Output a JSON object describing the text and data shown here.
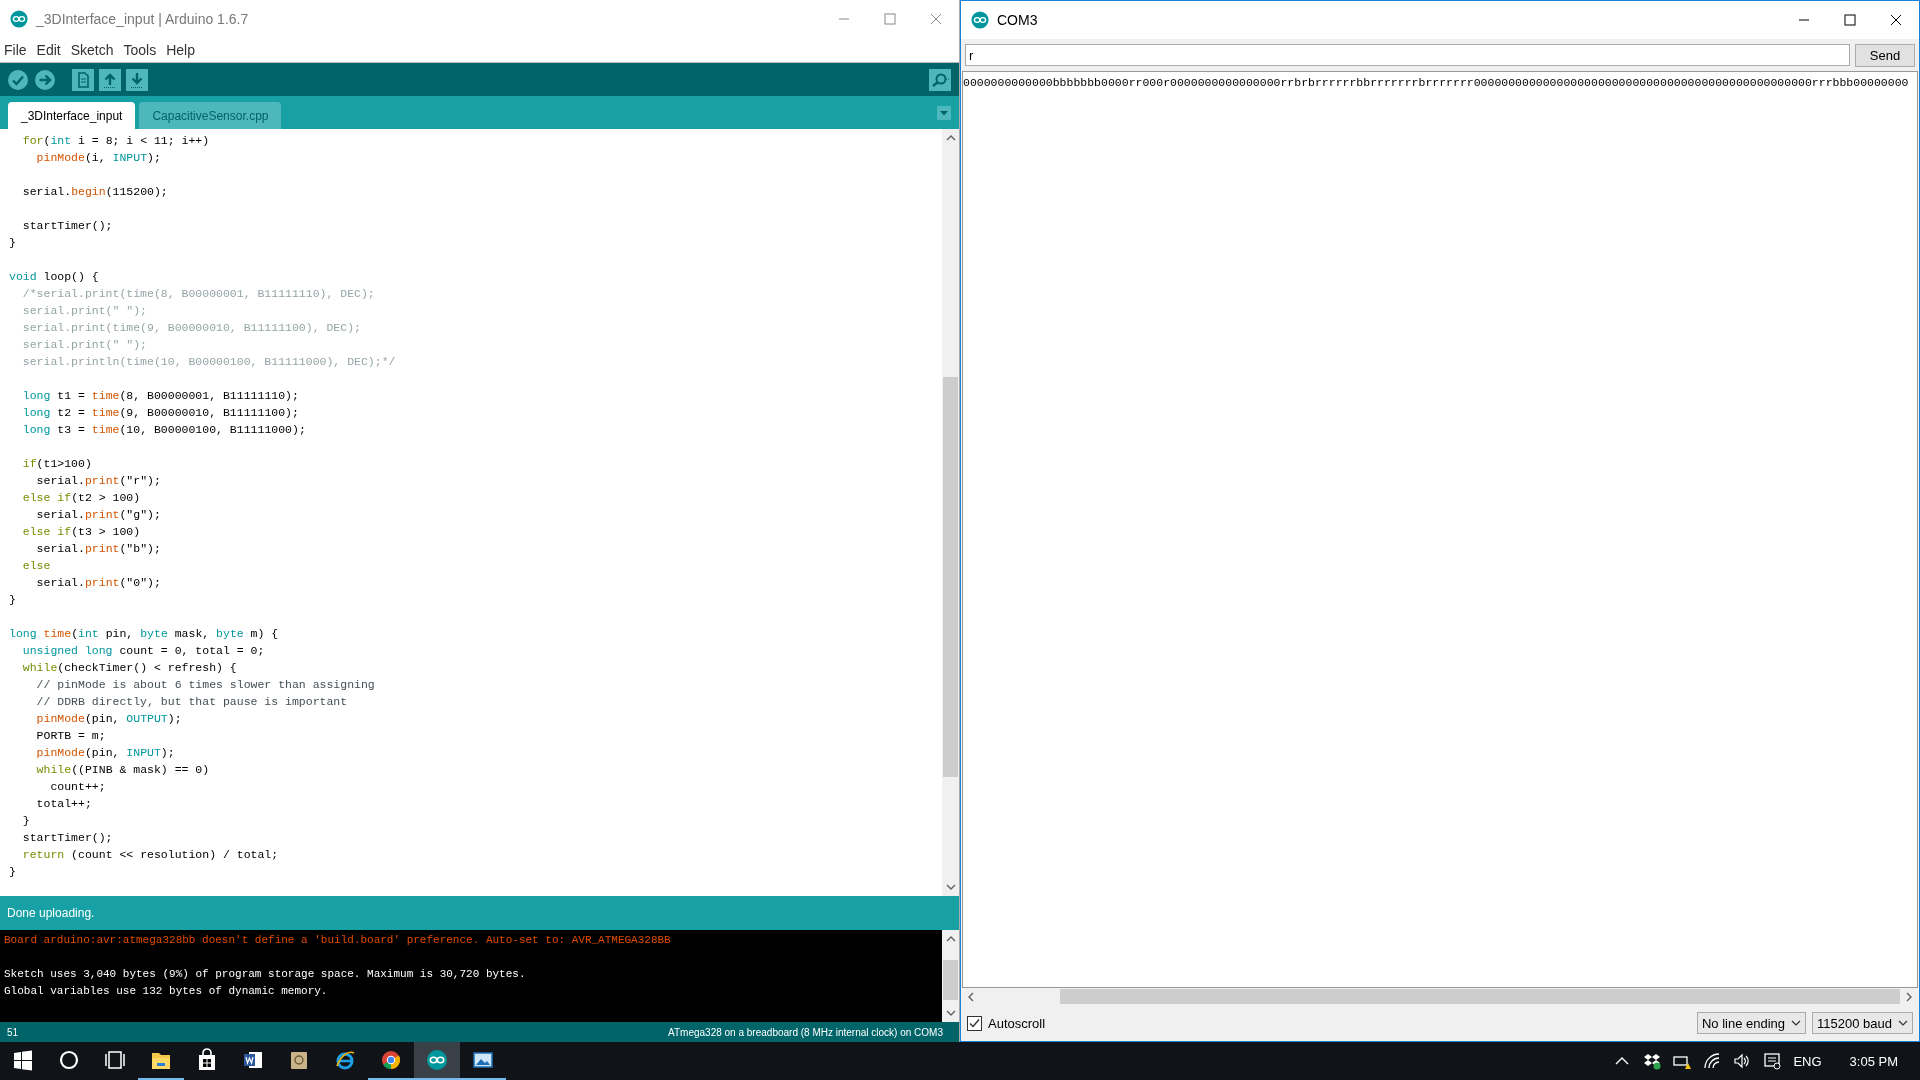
{
  "ide": {
    "title": "_3DInterface_input | Arduino 1.6.7",
    "menu": [
      "File",
      "Edit",
      "Sketch",
      "Tools",
      "Help"
    ],
    "tabs": [
      {
        "label": "_3DInterface_input",
        "selected": true
      },
      {
        "label": "CapacitiveSensor.cpp",
        "selected": false
      }
    ],
    "code_lines": [
      {
        "kind": "code",
        "tokens": [
          {
            "kind": "control",
            "text": "  for"
          },
          {
            "kind": "plain",
            "text": "("
          },
          {
            "kind": "type",
            "text": "int"
          },
          {
            "kind": "plain",
            "text": " i = 8; i < 11; i++)"
          }
        ]
      },
      {
        "kind": "code",
        "tokens": [
          {
            "kind": "function",
            "text": "    pinMode"
          },
          {
            "kind": "plain",
            "text": "(i, "
          },
          {
            "kind": "constant",
            "text": "INPUT"
          },
          {
            "kind": "plain",
            "text": ");"
          }
        ]
      },
      {
        "kind": "blank"
      },
      {
        "kind": "code",
        "tokens": [
          {
            "kind": "plain",
            "text": "  serial."
          },
          {
            "kind": "function",
            "text": "begin"
          },
          {
            "kind": "plain",
            "text": "(115200);"
          }
        ]
      },
      {
        "kind": "blank"
      },
      {
        "kind": "code",
        "tokens": [
          {
            "kind": "plain",
            "text": "  startTimer();"
          }
        ]
      },
      {
        "kind": "code",
        "tokens": [
          {
            "kind": "plain",
            "text": "}"
          }
        ]
      },
      {
        "kind": "blank"
      },
      {
        "kind": "code",
        "tokens": [
          {
            "kind": "type",
            "text": "void"
          },
          {
            "kind": "plain",
            "text": " loop() {"
          }
        ]
      },
      {
        "kind": "code",
        "tokens": [
          {
            "kind": "comment",
            "text": "  /*serial.print(time(8, B00000001, B11111110), DEC);"
          }
        ]
      },
      {
        "kind": "code",
        "tokens": [
          {
            "kind": "comment",
            "text": "  serial.print(\" \");"
          }
        ]
      },
      {
        "kind": "code",
        "tokens": [
          {
            "kind": "comment",
            "text": "  serial.print(time(9, B00000010, B11111100), DEC);"
          }
        ]
      },
      {
        "kind": "code",
        "tokens": [
          {
            "kind": "comment",
            "text": "  serial.print(\" \");"
          }
        ]
      },
      {
        "kind": "code",
        "tokens": [
          {
            "kind": "comment",
            "text": "  serial.println(time(10, B00000100, B11111000), DEC);*/"
          }
        ]
      },
      {
        "kind": "blank"
      },
      {
        "kind": "code",
        "tokens": [
          {
            "kind": "type",
            "text": "  long"
          },
          {
            "kind": "plain",
            "text": " t1 = "
          },
          {
            "kind": "function",
            "text": "time"
          },
          {
            "kind": "plain",
            "text": "(8, B00000001, B11111110);"
          }
        ]
      },
      {
        "kind": "code",
        "tokens": [
          {
            "kind": "type",
            "text": "  long"
          },
          {
            "kind": "plain",
            "text": " t2 = "
          },
          {
            "kind": "function",
            "text": "time"
          },
          {
            "kind": "plain",
            "text": "(9, B00000010, B11111100);"
          }
        ]
      },
      {
        "kind": "code",
        "tokens": [
          {
            "kind": "type",
            "text": "  long"
          },
          {
            "kind": "plain",
            "text": " t3 = "
          },
          {
            "kind": "function",
            "text": "time"
          },
          {
            "kind": "plain",
            "text": "(10, B00000100, B11111000);"
          }
        ]
      },
      {
        "kind": "blank"
      },
      {
        "kind": "code",
        "tokens": [
          {
            "kind": "control",
            "text": "  if"
          },
          {
            "kind": "plain",
            "text": "(t1>100)"
          }
        ]
      },
      {
        "kind": "code",
        "tokens": [
          {
            "kind": "plain",
            "text": "    serial."
          },
          {
            "kind": "function",
            "text": "print"
          },
          {
            "kind": "plain",
            "text": "(\"r\");"
          }
        ]
      },
      {
        "kind": "code",
        "tokens": [
          {
            "kind": "control",
            "text": "  else if"
          },
          {
            "kind": "plain",
            "text": "(t2 > 100)"
          }
        ]
      },
      {
        "kind": "code",
        "tokens": [
          {
            "kind": "plain",
            "text": "    serial."
          },
          {
            "kind": "function",
            "text": "print"
          },
          {
            "kind": "plain",
            "text": "(\"g\");"
          }
        ]
      },
      {
        "kind": "code",
        "tokens": [
          {
            "kind": "control",
            "text": "  else if"
          },
          {
            "kind": "plain",
            "text": "(t3 > 100)"
          }
        ]
      },
      {
        "kind": "code",
        "tokens": [
          {
            "kind": "plain",
            "text": "    serial."
          },
          {
            "kind": "function",
            "text": "print"
          },
          {
            "kind": "plain",
            "text": "(\"b\");"
          }
        ]
      },
      {
        "kind": "code",
        "tokens": [
          {
            "kind": "control",
            "text": "  else"
          }
        ]
      },
      {
        "kind": "code",
        "tokens": [
          {
            "kind": "plain",
            "text": "    serial."
          },
          {
            "kind": "function",
            "text": "print"
          },
          {
            "kind": "plain",
            "text": "(\"0\");"
          }
        ]
      },
      {
        "kind": "code",
        "tokens": [
          {
            "kind": "plain",
            "text": "}"
          }
        ]
      },
      {
        "kind": "blank"
      },
      {
        "kind": "code",
        "tokens": [
          {
            "kind": "type",
            "text": "long"
          },
          {
            "kind": "function",
            "text": " time"
          },
          {
            "kind": "plain",
            "text": "("
          },
          {
            "kind": "type",
            "text": "int"
          },
          {
            "kind": "plain",
            "text": " pin, "
          },
          {
            "kind": "type",
            "text": "byte"
          },
          {
            "kind": "plain",
            "text": " mask, "
          },
          {
            "kind": "type",
            "text": "byte"
          },
          {
            "kind": "plain",
            "text": " m) {"
          }
        ]
      },
      {
        "kind": "code",
        "tokens": [
          {
            "kind": "type",
            "text": "  unsigned long"
          },
          {
            "kind": "plain",
            "text": " count = 0, total = 0;"
          }
        ]
      },
      {
        "kind": "code",
        "tokens": [
          {
            "kind": "control",
            "text": "  while"
          },
          {
            "kind": "plain",
            "text": "(checkTimer() < refresh) {"
          }
        ]
      },
      {
        "kind": "code",
        "tokens": [
          {
            "kind": "note",
            "text": "    // pinMode is about 6 times slower than assigning"
          }
        ]
      },
      {
        "kind": "code",
        "tokens": [
          {
            "kind": "note",
            "text": "    // DDRB directly, but that pause is important"
          }
        ]
      },
      {
        "kind": "code",
        "tokens": [
          {
            "kind": "function",
            "text": "    pinMode"
          },
          {
            "kind": "plain",
            "text": "(pin, "
          },
          {
            "kind": "constant",
            "text": "OUTPUT"
          },
          {
            "kind": "plain",
            "text": ");"
          }
        ]
      },
      {
        "kind": "code",
        "tokens": [
          {
            "kind": "plain",
            "text": "    PORTB = m;"
          }
        ]
      },
      {
        "kind": "code",
        "tokens": [
          {
            "kind": "function",
            "text": "    pinMode"
          },
          {
            "kind": "plain",
            "text": "(pin, "
          },
          {
            "kind": "constant",
            "text": "INPUT"
          },
          {
            "kind": "plain",
            "text": ");"
          }
        ]
      },
      {
        "kind": "code",
        "tokens": [
          {
            "kind": "control",
            "text": "    while"
          },
          {
            "kind": "plain",
            "text": "((PINB & mask) == 0)"
          }
        ]
      },
      {
        "kind": "code",
        "tokens": [
          {
            "kind": "plain",
            "text": "      count++;"
          }
        ]
      },
      {
        "kind": "code",
        "tokens": [
          {
            "kind": "plain",
            "text": "    total++;"
          }
        ]
      },
      {
        "kind": "code",
        "tokens": [
          {
            "kind": "plain",
            "text": "  }"
          }
        ]
      },
      {
        "kind": "code",
        "tokens": [
          {
            "kind": "plain",
            "text": "  startTimer();"
          }
        ]
      },
      {
        "kind": "code",
        "tokens": [
          {
            "kind": "control",
            "text": "  return"
          },
          {
            "kind": "plain",
            "text": " (count << resolution) / total;"
          }
        ]
      },
      {
        "kind": "code",
        "tokens": [
          {
            "kind": "plain",
            "text": "}"
          }
        ]
      }
    ],
    "status": "Done uploading.",
    "console": [
      {
        "kind": "warning",
        "text": "Board arduino:avr:atmega328bb doesn't define a 'build.board' preference. Auto-set to: AVR_ATMEGA328BB"
      },
      {
        "kind": "blank"
      },
      {
        "kind": "info",
        "text": "Sketch uses 3,040 bytes (9%) of program storage space. Maximum is 30,720 bytes."
      },
      {
        "kind": "info",
        "text": "Global variables use 132 bytes of dynamic memory."
      }
    ],
    "line_number": "51",
    "board": "ATmega328 on a breadboard (8 MHz internal clock) on COM3"
  },
  "serial_monitor": {
    "title": "COM3",
    "input": "r",
    "send": "Send",
    "output": "0000000000000bbbbbbb0000rr000r0000000000000000rrbrbrrrrrrbbrrrrrrrbrrrrrrr0000000000000000000000000000000000000000000000000rrrbbb00000000",
    "autoscroll": {
      "label": "Autoscroll",
      "checked": true
    },
    "line_ending": "No line ending",
    "baud": "115200 baud"
  },
  "taskbar": {
    "apps": [
      {
        "kind": "start",
        "running": false,
        "selected": false
      },
      {
        "kind": "search",
        "running": false,
        "selected": false
      },
      {
        "kind": "task-view",
        "running": false,
        "selected": false
      },
      {
        "kind": "folder",
        "running": true,
        "selected": false
      },
      {
        "kind": "store",
        "running": false,
        "selected": false
      },
      {
        "kind": "word",
        "running": false,
        "selected": false
      },
      {
        "kind": "notebook",
        "running": false,
        "selected": false
      },
      {
        "kind": "ie",
        "running": false,
        "selected": false
      },
      {
        "kind": "chrome",
        "running": true,
        "selected": false
      },
      {
        "kind": "arduino",
        "running": true,
        "selected": true
      },
      {
        "kind": "photos",
        "running": true,
        "selected": false
      }
    ],
    "language": "ENG",
    "time": "3:05 PM"
  }
}
